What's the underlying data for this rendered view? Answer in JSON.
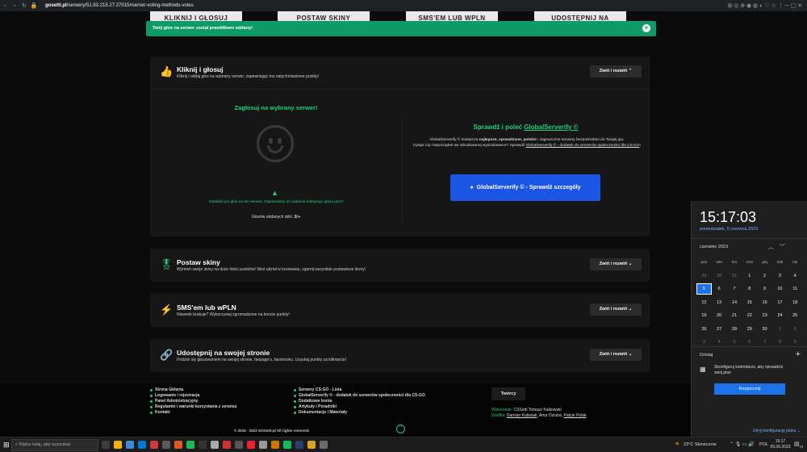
{
  "browser": {
    "url_host": "gosetti.pl",
    "url_path": "/serwery/51.83.215.27:27015#server-voting-methods-votes"
  },
  "top_cards": [
    "KLIKNIJ I GŁOSUJ",
    "POSTAW SKINY",
    "SMS'EM LUB WPLN",
    "UDOSTĘPNIJ NA"
  ],
  "toast": {
    "message": "Twój głos na serwer został prawidłowo oddany!"
  },
  "vote_section": {
    "title": "Kliknij i głosuj",
    "desc": "Kliknij i oddaj głos na wybrany serwer, zapewniając mu natychmiastowe punkty!",
    "toggle": "Zwiń / rozwiń",
    "left_title": "Zagłosuj na wybrany serwer!",
    "warning": "Oddałeś już głos na ten serwer. Zapraszamy do oddania kolejnego głosu jutro!",
    "votes_label": "Głosów oddanych dziś:",
    "votes_value": "2/∞",
    "right_title_a": "Sprawdź i poleć ",
    "right_title_b": "GlobalServerify ©",
    "right_p1": "GlobalServerify © dostarcza ",
    "right_p1b": "najlepsze, sprawdzone, polskie",
    "right_p1c": " i zagraniczne serwery bezpośrednio do Twojej gry.",
    "right_p2": "Irytuje Cię nieporządek we wbudowanej wyszukiwarce? Sprawdź ",
    "right_p2link": "GlobalServerify © - dodatek do serwerów społeczności dla CS:GO",
    "right_p2end": "!",
    "cta": "GlobalServerify © - Sprawdź szczegóły"
  },
  "sections": [
    {
      "title": "Postaw skiny",
      "desc": "Wymień swoje skiny na duże ilości punktów! Weź udział w losowaniu, zgarnij wszystkie postawione itemy!",
      "toggle": "Zwiń / rozwiń"
    },
    {
      "title": "SMS'em lub wPLN",
      "desc": "Niewiele brakuje? Wykorzystaj zgromadzone na koncie punkty!",
      "toggle": "Zwiń / rozwiń"
    },
    {
      "title": "Udostępnij na swojej stronie",
      "desc": "Podziel się głosowaniem na swojej stronie, fanpage'u, facebooku. Uzyskaj punkty za kliknięcia!",
      "toggle": "Zwiń / rozwiń"
    }
  ],
  "footer": {
    "col1": [
      "Strona Główna",
      "Logowanie i rejestracja",
      "Panel Administracyjny",
      "Regulamin i warunki korzystania z serwisu",
      "Kontakt"
    ],
    "col2": [
      "Serwery CS:GO - Lista",
      "GlobalServerify ® - dodatek do serwerów społeczności dla CS:GO",
      "Dodatkowe konta",
      "Artykuły i Poradniki",
      "Dokumentacje i Materiały"
    ],
    "creators_btn": "Twórcy",
    "made_label": "Wykonanie:",
    "made_value": "CSSetti Tomasz Kalkowski",
    "gfx_label": "Grafika:",
    "gfx_a": "Damian Kubisiak",
    "gfx_b": ", Artur Dziuba, ",
    "gfx_c": "Patryk Polak",
    "copyright": "© 2016 - 2023 GOSetti.pl All rights reserved."
  },
  "calendar": {
    "time": "15:17:03",
    "date": "poniedziałek, 5 czerwca 2023",
    "month": "czerwiec 2023",
    "weekdays": [
      "pon",
      "wto",
      "śro",
      "czw",
      "pią",
      "sob",
      "nie"
    ],
    "weeks": [
      [
        "29",
        "30",
        "31",
        "1",
        "2",
        "3",
        "4"
      ],
      [
        "5",
        "6",
        "7",
        "8",
        "9",
        "10",
        "11"
      ],
      [
        "12",
        "13",
        "14",
        "15",
        "16",
        "17",
        "18"
      ],
      [
        "19",
        "20",
        "21",
        "22",
        "23",
        "24",
        "25"
      ],
      [
        "26",
        "27",
        "28",
        "29",
        "30",
        "1",
        "2"
      ],
      [
        "3",
        "4",
        "5",
        "6",
        "7",
        "8",
        "9"
      ]
    ],
    "today_label": "Dzisiaj",
    "add": "+",
    "event_msg": "Skonfiguruj kalendarze, aby sprawdzić swój plan",
    "start_btn": "Rozpocznij",
    "hide": "Ukryj konfigurację planu ⌄"
  },
  "taskbar": {
    "search_placeholder": "Wpisz tutaj, aby wyszukać",
    "weather": "23°C  Słonecznie",
    "lang": "POL",
    "clock_time": "15:17",
    "clock_date": "05.06.2023",
    "notif": "23"
  }
}
